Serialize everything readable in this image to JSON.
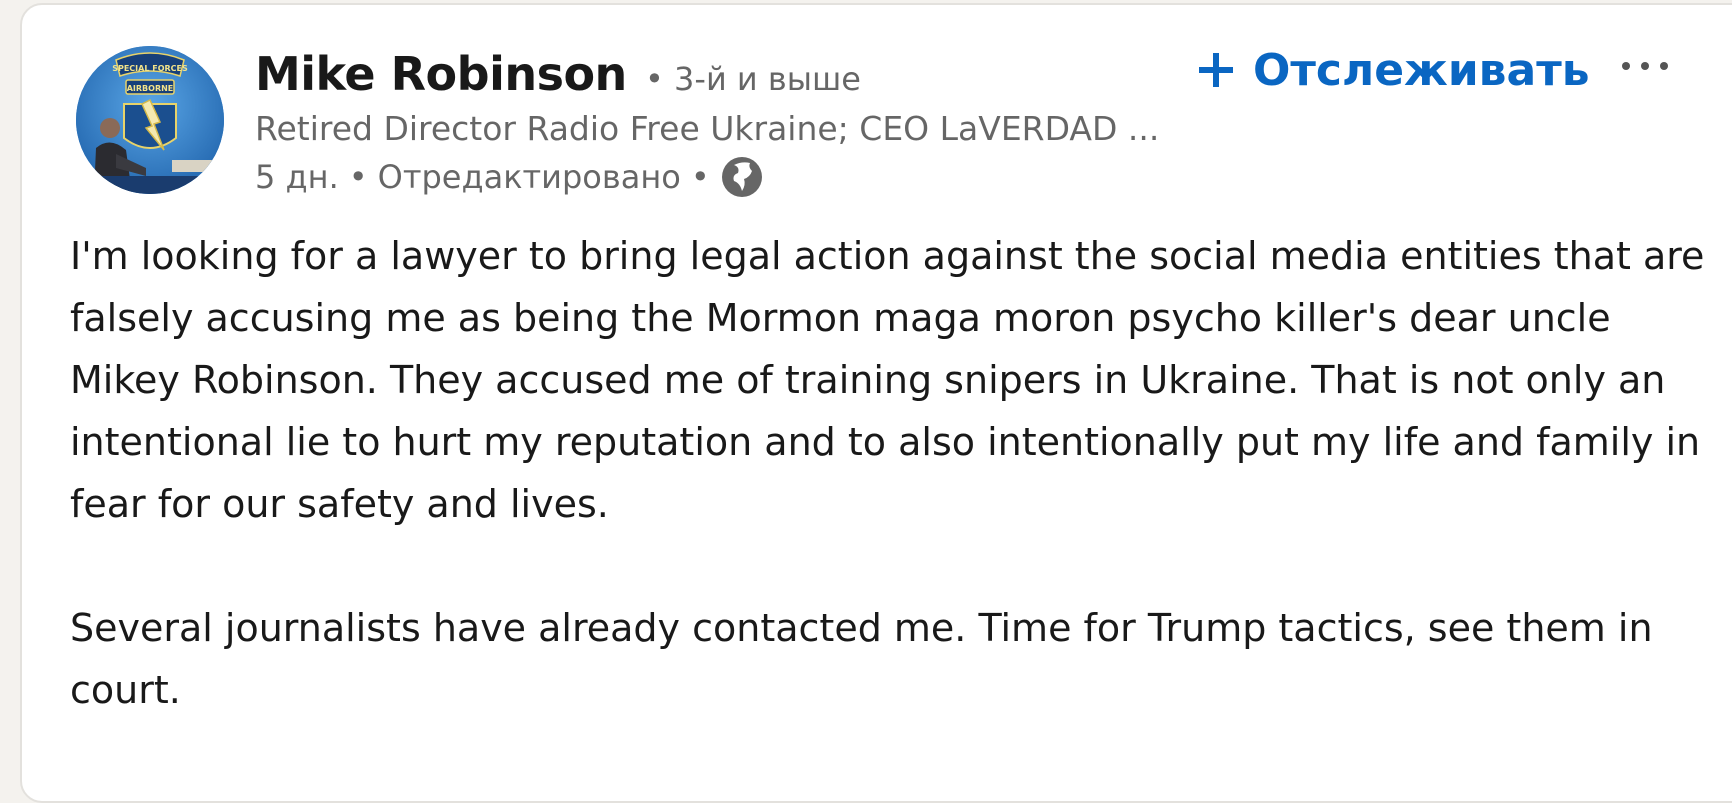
{
  "post": {
    "author": {
      "name": "Mike Robinson",
      "degree": " • 3-й и выше",
      "headline": "Retired Director Radio Free Ukraine; CEO LaVERDAD ...",
      "avatar_text_top": "SPECIAL FORCES",
      "avatar_text_tab": "AIRBORNE"
    },
    "meta": {
      "time": "5 дн.",
      "separator": "•",
      "edited": "Отредактировано",
      "visibility_icon": "globe-icon"
    },
    "actions": {
      "follow_label": "Отслеживать",
      "follow_icon": "plus-icon",
      "more_icon": "more-horizontal-icon"
    },
    "body": {
      "paragraph_1": "I'm looking for a lawyer to bring legal action against the social media entities that are falsely accusing me as being the Mormon maga moron psycho killer's dear uncle Mikey Robinson. They accused me of training snipers in Ukraine. That is not only an intentional lie to hurt my reputation and to also intentionally put my life and family in fear for our safety and lives.",
      "paragraph_2": "Several journalists have already contacted me. Time for Trump tactics, see them in court."
    }
  },
  "colors": {
    "accent": "#0a66c2",
    "page_bg": "#f4f2ee",
    "card_bg": "#ffffff"
  }
}
